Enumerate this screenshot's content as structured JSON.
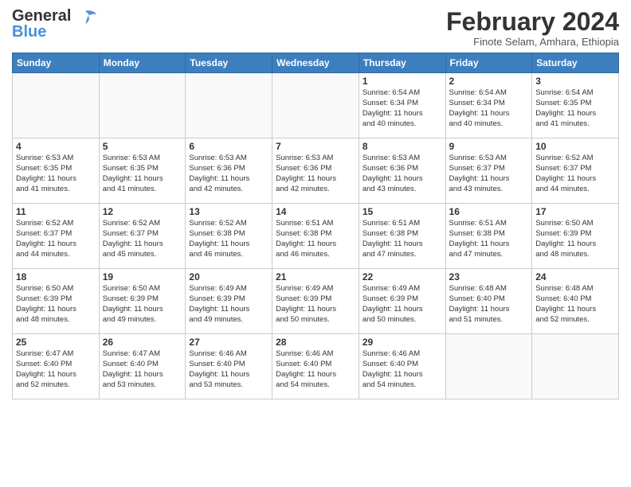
{
  "header": {
    "logo_line1": "General",
    "logo_line2": "Blue",
    "month": "February 2024",
    "location": "Finote Selam, Amhara, Ethiopia"
  },
  "weekdays": [
    "Sunday",
    "Monday",
    "Tuesday",
    "Wednesday",
    "Thursday",
    "Friday",
    "Saturday"
  ],
  "weeks": [
    [
      {
        "day": "",
        "info": ""
      },
      {
        "day": "",
        "info": ""
      },
      {
        "day": "",
        "info": ""
      },
      {
        "day": "",
        "info": ""
      },
      {
        "day": "1",
        "info": "Sunrise: 6:54 AM\nSunset: 6:34 PM\nDaylight: 11 hours\nand 40 minutes."
      },
      {
        "day": "2",
        "info": "Sunrise: 6:54 AM\nSunset: 6:34 PM\nDaylight: 11 hours\nand 40 minutes."
      },
      {
        "day": "3",
        "info": "Sunrise: 6:54 AM\nSunset: 6:35 PM\nDaylight: 11 hours\nand 41 minutes."
      }
    ],
    [
      {
        "day": "4",
        "info": "Sunrise: 6:53 AM\nSunset: 6:35 PM\nDaylight: 11 hours\nand 41 minutes."
      },
      {
        "day": "5",
        "info": "Sunrise: 6:53 AM\nSunset: 6:35 PM\nDaylight: 11 hours\nand 41 minutes."
      },
      {
        "day": "6",
        "info": "Sunrise: 6:53 AM\nSunset: 6:36 PM\nDaylight: 11 hours\nand 42 minutes."
      },
      {
        "day": "7",
        "info": "Sunrise: 6:53 AM\nSunset: 6:36 PM\nDaylight: 11 hours\nand 42 minutes."
      },
      {
        "day": "8",
        "info": "Sunrise: 6:53 AM\nSunset: 6:36 PM\nDaylight: 11 hours\nand 43 minutes."
      },
      {
        "day": "9",
        "info": "Sunrise: 6:53 AM\nSunset: 6:37 PM\nDaylight: 11 hours\nand 43 minutes."
      },
      {
        "day": "10",
        "info": "Sunrise: 6:52 AM\nSunset: 6:37 PM\nDaylight: 11 hours\nand 44 minutes."
      }
    ],
    [
      {
        "day": "11",
        "info": "Sunrise: 6:52 AM\nSunset: 6:37 PM\nDaylight: 11 hours\nand 44 minutes."
      },
      {
        "day": "12",
        "info": "Sunrise: 6:52 AM\nSunset: 6:37 PM\nDaylight: 11 hours\nand 45 minutes."
      },
      {
        "day": "13",
        "info": "Sunrise: 6:52 AM\nSunset: 6:38 PM\nDaylight: 11 hours\nand 46 minutes."
      },
      {
        "day": "14",
        "info": "Sunrise: 6:51 AM\nSunset: 6:38 PM\nDaylight: 11 hours\nand 46 minutes."
      },
      {
        "day": "15",
        "info": "Sunrise: 6:51 AM\nSunset: 6:38 PM\nDaylight: 11 hours\nand 47 minutes."
      },
      {
        "day": "16",
        "info": "Sunrise: 6:51 AM\nSunset: 6:38 PM\nDaylight: 11 hours\nand 47 minutes."
      },
      {
        "day": "17",
        "info": "Sunrise: 6:50 AM\nSunset: 6:39 PM\nDaylight: 11 hours\nand 48 minutes."
      }
    ],
    [
      {
        "day": "18",
        "info": "Sunrise: 6:50 AM\nSunset: 6:39 PM\nDaylight: 11 hours\nand 48 minutes."
      },
      {
        "day": "19",
        "info": "Sunrise: 6:50 AM\nSunset: 6:39 PM\nDaylight: 11 hours\nand 49 minutes."
      },
      {
        "day": "20",
        "info": "Sunrise: 6:49 AM\nSunset: 6:39 PM\nDaylight: 11 hours\nand 49 minutes."
      },
      {
        "day": "21",
        "info": "Sunrise: 6:49 AM\nSunset: 6:39 PM\nDaylight: 11 hours\nand 50 minutes."
      },
      {
        "day": "22",
        "info": "Sunrise: 6:49 AM\nSunset: 6:39 PM\nDaylight: 11 hours\nand 50 minutes."
      },
      {
        "day": "23",
        "info": "Sunrise: 6:48 AM\nSunset: 6:40 PM\nDaylight: 11 hours\nand 51 minutes."
      },
      {
        "day": "24",
        "info": "Sunrise: 6:48 AM\nSunset: 6:40 PM\nDaylight: 11 hours\nand 52 minutes."
      }
    ],
    [
      {
        "day": "25",
        "info": "Sunrise: 6:47 AM\nSunset: 6:40 PM\nDaylight: 11 hours\nand 52 minutes."
      },
      {
        "day": "26",
        "info": "Sunrise: 6:47 AM\nSunset: 6:40 PM\nDaylight: 11 hours\nand 53 minutes."
      },
      {
        "day": "27",
        "info": "Sunrise: 6:46 AM\nSunset: 6:40 PM\nDaylight: 11 hours\nand 53 minutes."
      },
      {
        "day": "28",
        "info": "Sunrise: 6:46 AM\nSunset: 6:40 PM\nDaylight: 11 hours\nand 54 minutes."
      },
      {
        "day": "29",
        "info": "Sunrise: 6:46 AM\nSunset: 6:40 PM\nDaylight: 11 hours\nand 54 minutes."
      },
      {
        "day": "",
        "info": ""
      },
      {
        "day": "",
        "info": ""
      }
    ]
  ]
}
